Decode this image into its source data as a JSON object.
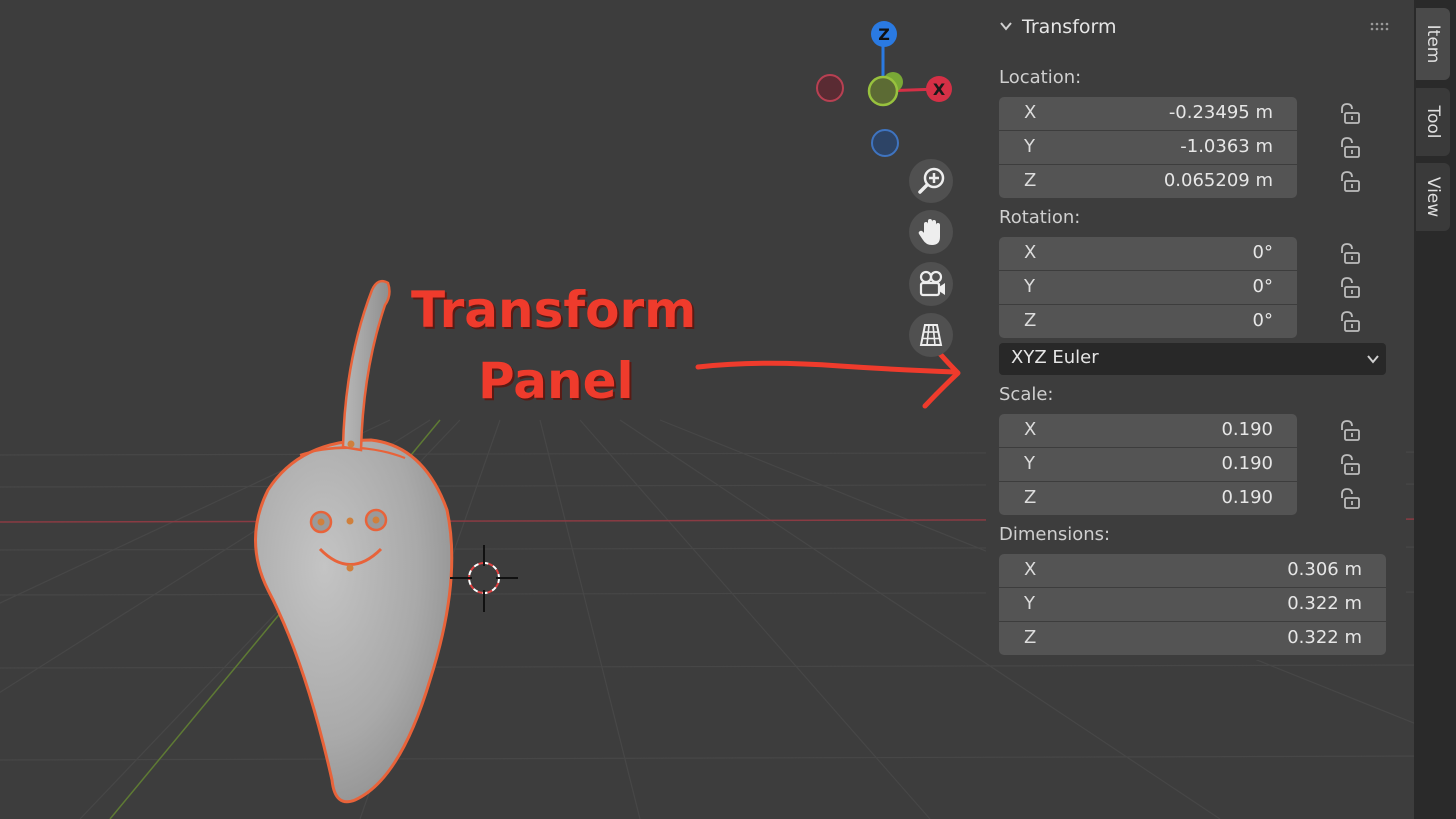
{
  "panel": {
    "title": "Transform",
    "location": {
      "label": "Location:",
      "rows": [
        {
          "axis": "X",
          "value": "-0.23495 m"
        },
        {
          "axis": "Y",
          "value": "-1.0363 m"
        },
        {
          "axis": "Z",
          "value": "0.065209 m"
        }
      ]
    },
    "rotation": {
      "label": "Rotation:",
      "rows": [
        {
          "axis": "X",
          "value": "0°"
        },
        {
          "axis": "Y",
          "value": "0°"
        },
        {
          "axis": "Z",
          "value": "0°"
        }
      ],
      "mode": "XYZ Euler"
    },
    "scale": {
      "label": "Scale:",
      "rows": [
        {
          "axis": "X",
          "value": "0.190"
        },
        {
          "axis": "Y",
          "value": "0.190"
        },
        {
          "axis": "Z",
          "value": "0.190"
        }
      ]
    },
    "dimensions": {
      "label": "Dimensions:",
      "rows": [
        {
          "axis": "X",
          "value": "0.306 m"
        },
        {
          "axis": "Y",
          "value": "0.322 m"
        },
        {
          "axis": "Z",
          "value": "0.322 m"
        }
      ]
    }
  },
  "tabs": [
    "Item",
    "Tool",
    "View"
  ],
  "gizmo": {
    "x_label": "X",
    "z_label": "Z"
  },
  "nav_icons": [
    "zoom-icon",
    "hand-pan-icon",
    "camera-icon",
    "grid-ortho-icon"
  ],
  "annotation": {
    "line1": "Transform",
    "line2": "Panel",
    "color": "#ef3b2c"
  },
  "colors": {
    "x_axis": "#d53046",
    "y_axis": "#79a836",
    "z_axis": "#2a7ae2",
    "selection_outline": "#e8633a"
  }
}
